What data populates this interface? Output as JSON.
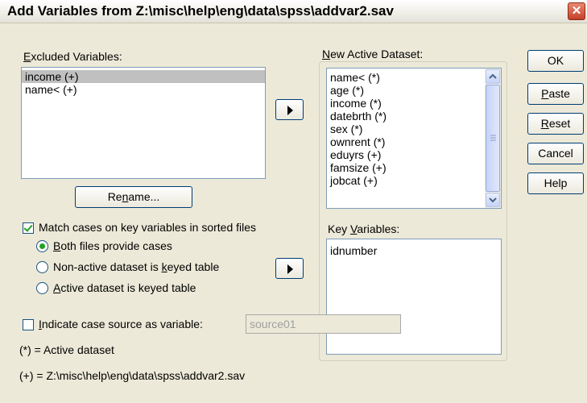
{
  "window": {
    "title": "Add Variables from Z:\\misc\\help\\eng\\data\\spss\\addvar2.sav",
    "close_glyph": "✕"
  },
  "excluded": {
    "label_u": "E",
    "label_rest": "xcluded Variables:",
    "items": [
      {
        "text": "income (+)",
        "selected": true
      },
      {
        "text": "name< (+)",
        "selected": false
      }
    ],
    "rename_pre": "Re",
    "rename_u": "n",
    "rename_post": "ame..."
  },
  "new_active": {
    "label_u": "N",
    "label_rest": "ew Active Dataset:",
    "items": [
      "name< (*)",
      "age (*)",
      "income (*)",
      "datebrth (*)",
      "sex (*)",
      "ownrent (*)",
      "eduyrs (+)",
      "famsize (+)",
      "jobcat (+)"
    ]
  },
  "key_vars": {
    "label_pre": "Key ",
    "label_u": "V",
    "label_post": "ariables:",
    "items": [
      "idnumber"
    ]
  },
  "match": {
    "checked": true,
    "label": "Match cases on key variables in sorted files",
    "options": [
      {
        "pre": "",
        "u": "B",
        "post": "oth files provide cases",
        "selected": true
      },
      {
        "pre": "Non-active dataset is ",
        "u": "k",
        "post": "eyed table",
        "selected": false
      },
      {
        "pre": "",
        "u": "A",
        "post": "ctive dataset is keyed table",
        "selected": false
      }
    ]
  },
  "indicate": {
    "checked": false,
    "label_u": "I",
    "label_rest": "ndicate case source as variable:",
    "value": "source01"
  },
  "legend": {
    "active": "(*) = Active dataset",
    "other": "(+) = Z:\\misc\\help\\eng\\data\\spss\\addvar2.sav"
  },
  "buttons": {
    "ok": "OK",
    "paste_u": "P",
    "paste_rest": "aste",
    "reset_u": "R",
    "reset_rest": "eset",
    "cancel": "Cancel",
    "help": "Help"
  }
}
